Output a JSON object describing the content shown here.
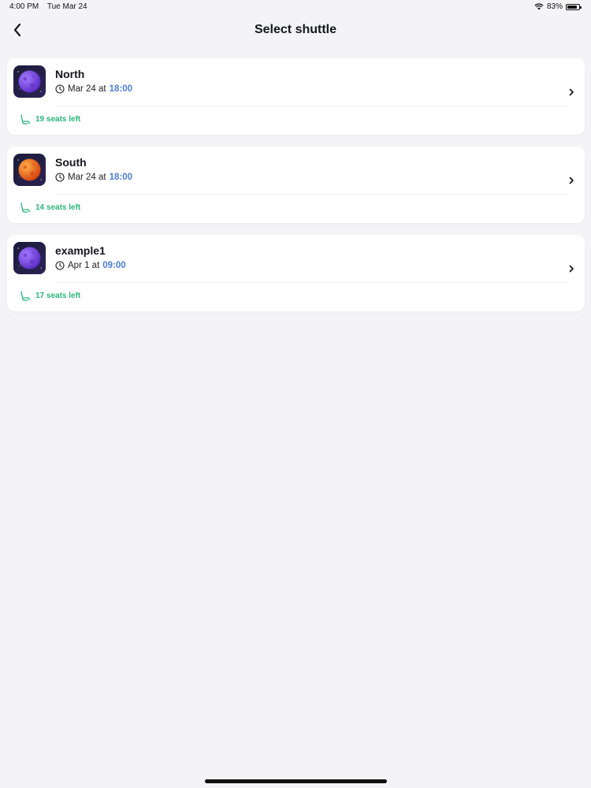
{
  "status_bar": {
    "time": "4:00 PM",
    "date": "Tue Mar 24",
    "battery": "83%",
    "battery_level": 0.83
  },
  "nav": {
    "title": "Select shuttle",
    "back_icon": "chevron-left-icon"
  },
  "shuttles": [
    {
      "name": "North",
      "date_text": "Mar 24 at",
      "time": "18:00",
      "seats": "19 seats left",
      "planet_color": "#7b3fe4"
    },
    {
      "name": "South",
      "date_text": "Mar 24 at",
      "time": "18:00",
      "seats": "14 seats left",
      "planet_color": "#f07a1a"
    },
    {
      "name": "example1",
      "date_text": "Apr 1 at",
      "time": "09:00",
      "seats": "17 seats left",
      "planet_color": "#7b3fe4"
    }
  ],
  "colors": {
    "accent_time": "#4a7fd6",
    "seats_green": "#2bb57a",
    "background": "#f4f4f7"
  }
}
